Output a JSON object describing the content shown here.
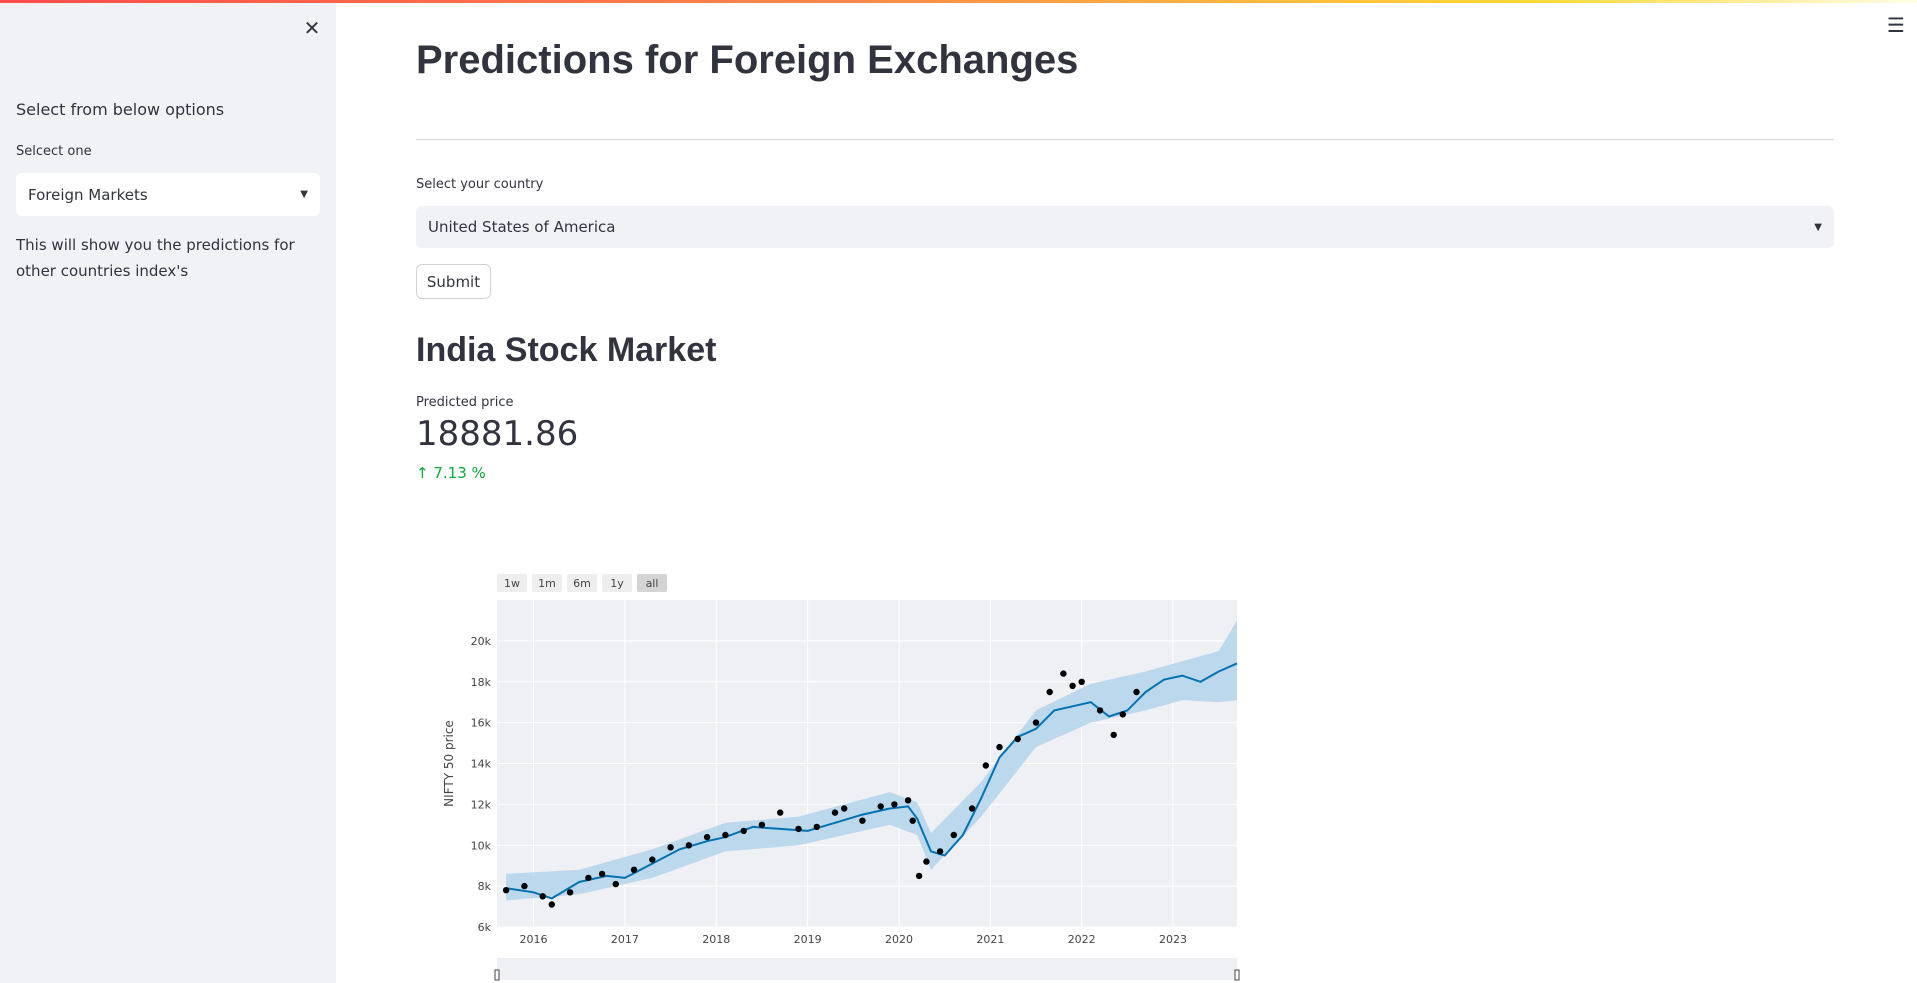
{
  "sidebar": {
    "close_icon": "close-icon",
    "heading": "Select from below options",
    "select_label": "Selcect one",
    "select_value": "Foreign Markets",
    "info": "This will show you the predictions for other countries index's"
  },
  "header": {
    "menu_icon": "hamburger-menu-icon"
  },
  "main": {
    "title": "Predictions for Foreign Exchanges",
    "country_label": "Select your country",
    "country_value": "United States of America",
    "submit_label": "Submit",
    "subtitle": "India Stock Market",
    "metric": {
      "label": "Predicted price",
      "value": "18881.86",
      "delta_arrow": "↑",
      "delta": "7.13 %"
    }
  },
  "colors": {
    "accent_gradient": [
      "#ff4b4b",
      "#fdd835"
    ],
    "delta_positive": "#09ab3b",
    "forecast_line": "#0072b2",
    "forecast_band": "#b3d4ea",
    "actual_points": "#000000"
  },
  "chart_data": {
    "type": "line",
    "ylabel": "NIFTY 50 price",
    "xlabel": "",
    "range_buttons": [
      "1w",
      "1m",
      "6m",
      "1y",
      "all"
    ],
    "active_range": "all",
    "x_ticks": [
      "2016",
      "2017",
      "2018",
      "2019",
      "2020",
      "2021",
      "2022",
      "2023"
    ],
    "y_ticks": [
      "6k",
      "8k",
      "10k",
      "12k",
      "14k",
      "16k",
      "18k",
      "20k"
    ],
    "xlim": [
      2015.6,
      2023.7
    ],
    "ylim": [
      6000,
      22000
    ],
    "grid": true,
    "series": [
      {
        "kind": "forecast",
        "x": [
          2015.7,
          2016.0,
          2016.2,
          2016.5,
          2016.8,
          2017.0,
          2017.3,
          2017.6,
          2017.9,
          2018.1,
          2018.4,
          2018.7,
          2019.0,
          2019.3,
          2019.6,
          2019.9,
          2020.1,
          2020.2,
          2020.35,
          2020.5,
          2020.7,
          2020.9,
          2021.1,
          2021.3,
          2021.5,
          2021.7,
          2021.9,
          2022.1,
          2022.3,
          2022.5,
          2022.7,
          2022.9,
          2023.1,
          2023.3,
          2023.5,
          2023.7
        ],
        "y": [
          7900,
          7700,
          7400,
          8200,
          8500,
          8400,
          9100,
          9800,
          10200,
          10400,
          10900,
          10800,
          10700,
          11100,
          11500,
          11800,
          11900,
          11300,
          9700,
          9500,
          10500,
          12300,
          14300,
          15300,
          15700,
          16600,
          16800,
          17000,
          16300,
          16600,
          17500,
          18100,
          18300,
          18000,
          18500,
          18900
        ]
      },
      {
        "kind": "forecast_band",
        "x": [
          2015.7,
          2016.5,
          2017.3,
          2018.1,
          2018.9,
          2019.9,
          2020.2,
          2020.35,
          2020.9,
          2021.5,
          2022.1,
          2022.7,
          2023.1,
          2023.5,
          2023.7
        ],
        "lower": [
          7300,
          7600,
          8400,
          9700,
          10000,
          11000,
          10500,
          8800,
          11400,
          14800,
          16000,
          16600,
          17100,
          17000,
          17100
        ],
        "upper": [
          8600,
          8800,
          9800,
          11100,
          11400,
          12600,
          12100,
          10600,
          13100,
          16600,
          17900,
          18500,
          19000,
          19500,
          21000
        ]
      },
      {
        "kind": "actual",
        "x": [
          2015.7,
          2015.9,
          2016.1,
          2016.2,
          2016.4,
          2016.6,
          2016.75,
          2016.9,
          2017.1,
          2017.3,
          2017.5,
          2017.7,
          2017.9,
          2018.1,
          2018.3,
          2018.5,
          2018.7,
          2018.9,
          2019.1,
          2019.3,
          2019.4,
          2019.6,
          2019.8,
          2019.95,
          2020.1,
          2020.15,
          2020.22,
          2020.3,
          2020.45,
          2020.6,
          2020.8,
          2020.95,
          2021.1,
          2021.3,
          2021.5,
          2021.65,
          2021.8,
          2021.9,
          2022.0,
          2022.2,
          2022.35,
          2022.45,
          2022.6
        ],
        "y": [
          7800,
          8000,
          7500,
          7100,
          7700,
          8400,
          8600,
          8100,
          8800,
          9300,
          9900,
          10000,
          10400,
          10500,
          10700,
          11000,
          11600,
          10800,
          10900,
          11600,
          11800,
          11200,
          11900,
          12000,
          12200,
          11200,
          8500,
          9200,
          9700,
          10500,
          11800,
          13900,
          14800,
          15200,
          16000,
          17500,
          18400,
          17800,
          18000,
          16600,
          15400,
          16400,
          17500
        ]
      }
    ]
  }
}
